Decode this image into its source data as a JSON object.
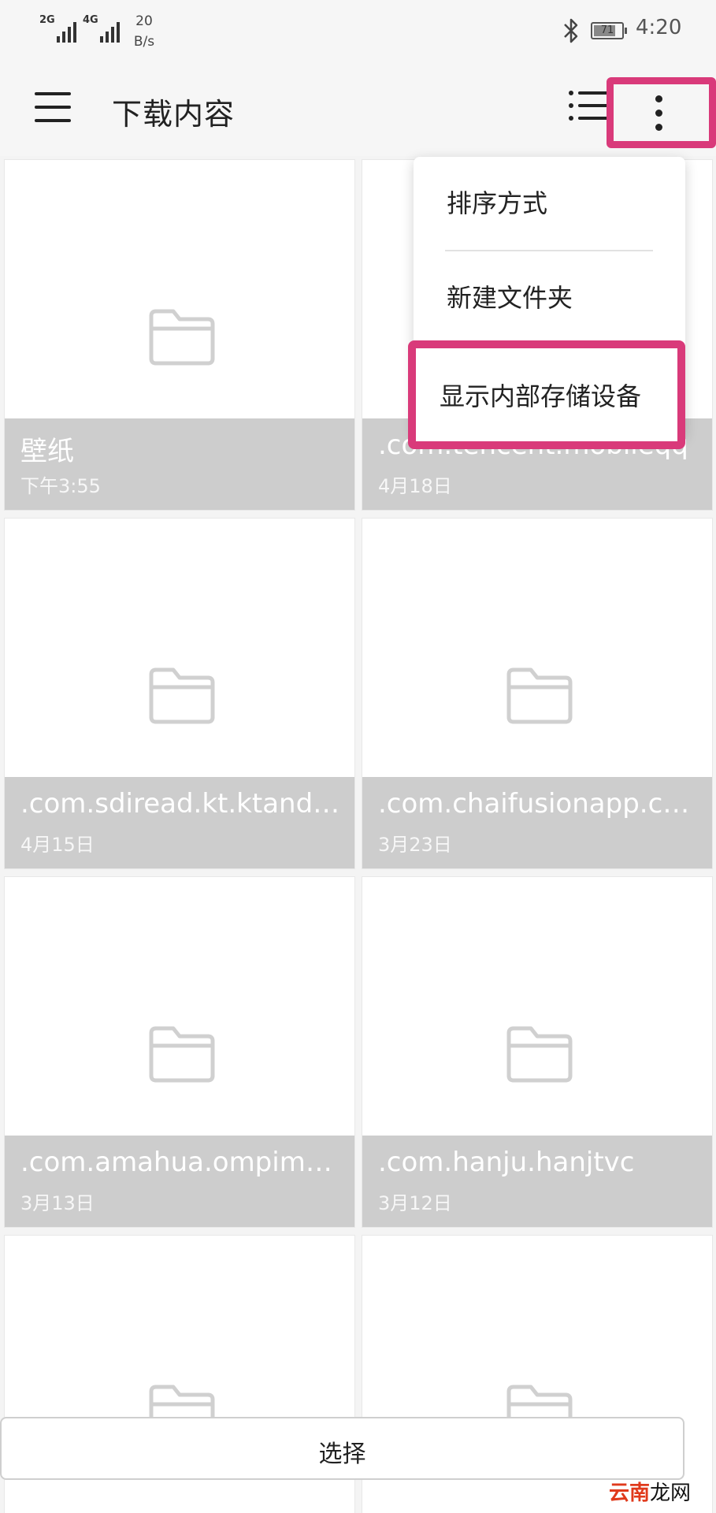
{
  "status_bar": {
    "signal_2g_label": "2G",
    "signal_4g_label": "4G",
    "net_speed_value": "20",
    "net_speed_unit": "B/s",
    "battery_level": "71",
    "time": "4:20",
    "icons": [
      "signal-2g-icon",
      "signal-4g-icon",
      "bluetooth-icon",
      "battery-icon"
    ]
  },
  "app_bar": {
    "title": "下载内容",
    "icons": [
      "menu-icon",
      "list-view-icon",
      "more-vertical-icon"
    ]
  },
  "menu": {
    "items": [
      {
        "label": "排序方式"
      },
      {
        "label": "新建文件夹"
      },
      {
        "label": "显示内部存储设备"
      }
    ],
    "highlight_color": "#d93a7a"
  },
  "folders": [
    {
      "name": "壁纸",
      "date": "下午3:55"
    },
    {
      "name": ".com.tencent.mobileqq",
      "date": "4月18日"
    },
    {
      "name": ".com.sdiread.kt.ktandroid",
      "date": "4月15日"
    },
    {
      "name": ".com.chaifusionapp.camera",
      "date": "3月23日"
    },
    {
      "name": ".com.amahua.ompimdrt",
      "date": "3月13日"
    },
    {
      "name": ".com.hanju.hanjtvc",
      "date": "3月12日"
    },
    {
      "name": "",
      "date": ""
    },
    {
      "name": "",
      "date": ""
    }
  ],
  "bottom": {
    "select_label": "选择"
  },
  "watermark": {
    "part1": "云南",
    "part2": "龙网"
  }
}
